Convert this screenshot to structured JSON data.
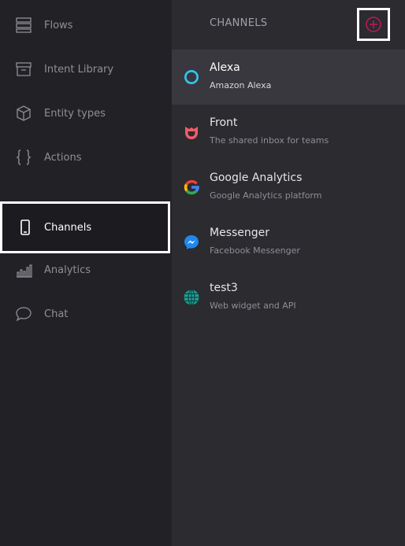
{
  "sidebar": {
    "items": [
      {
        "label": "Flows",
        "icon": "flows-icon"
      },
      {
        "label": "Intent Library",
        "icon": "archive-icon"
      },
      {
        "label": "Entity types",
        "icon": "cube-icon"
      },
      {
        "label": "Actions",
        "icon": "braces-icon"
      },
      {
        "label": "Channels",
        "icon": "phone-icon",
        "active": true
      },
      {
        "label": "Analytics",
        "icon": "bar-chart-icon"
      },
      {
        "label": "Chat",
        "icon": "speech-bubble-icon"
      }
    ]
  },
  "main": {
    "title": "CHANNELS",
    "add_icon": "plus-circle-icon",
    "accent": "#c2185b",
    "channels": [
      {
        "name": "Alexa",
        "description": "Amazon Alexa",
        "icon": "alexa-icon",
        "selected": true
      },
      {
        "name": "Front",
        "description": "The shared inbox for teams",
        "icon": "front-icon"
      },
      {
        "name": "Google Analytics",
        "description": "Google Analytics platform",
        "icon": "google-icon"
      },
      {
        "name": "Messenger",
        "description": "Facebook Messenger",
        "icon": "messenger-icon"
      },
      {
        "name": "test3",
        "description": "Web widget and API",
        "icon": "globe-icon"
      }
    ]
  }
}
